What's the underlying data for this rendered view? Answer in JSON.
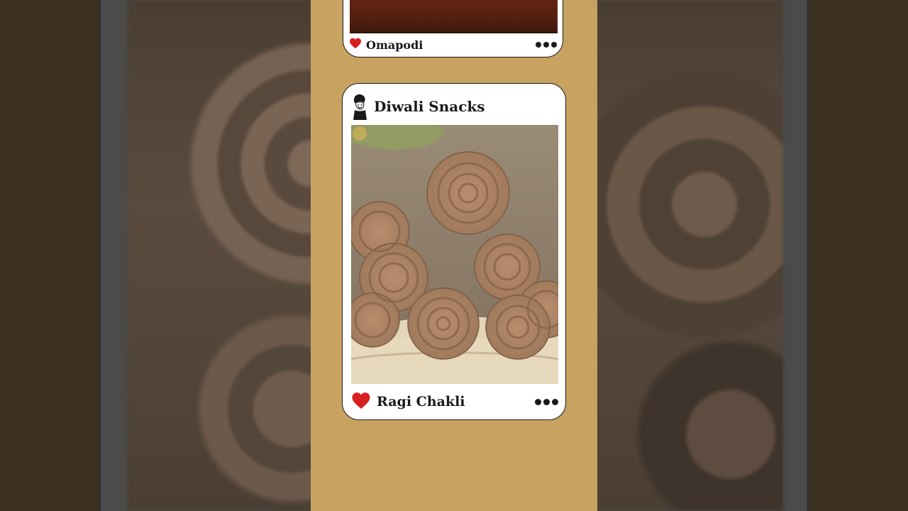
{
  "top_card": {
    "item_title": "Omapodi",
    "like_icon": "heart-icon",
    "more_icon": "more-options-icon"
  },
  "main_card": {
    "header_title": "Diwali Snacks",
    "avatar_icon": "chef-avatar-icon",
    "item_title": "Ragi Chakli",
    "like_icon": "heart-icon",
    "more_icon": "more-options-icon"
  },
  "colors": {
    "panel_background": "#c8a261",
    "heart": "#d81f1f",
    "text": "#1a1a1a"
  }
}
